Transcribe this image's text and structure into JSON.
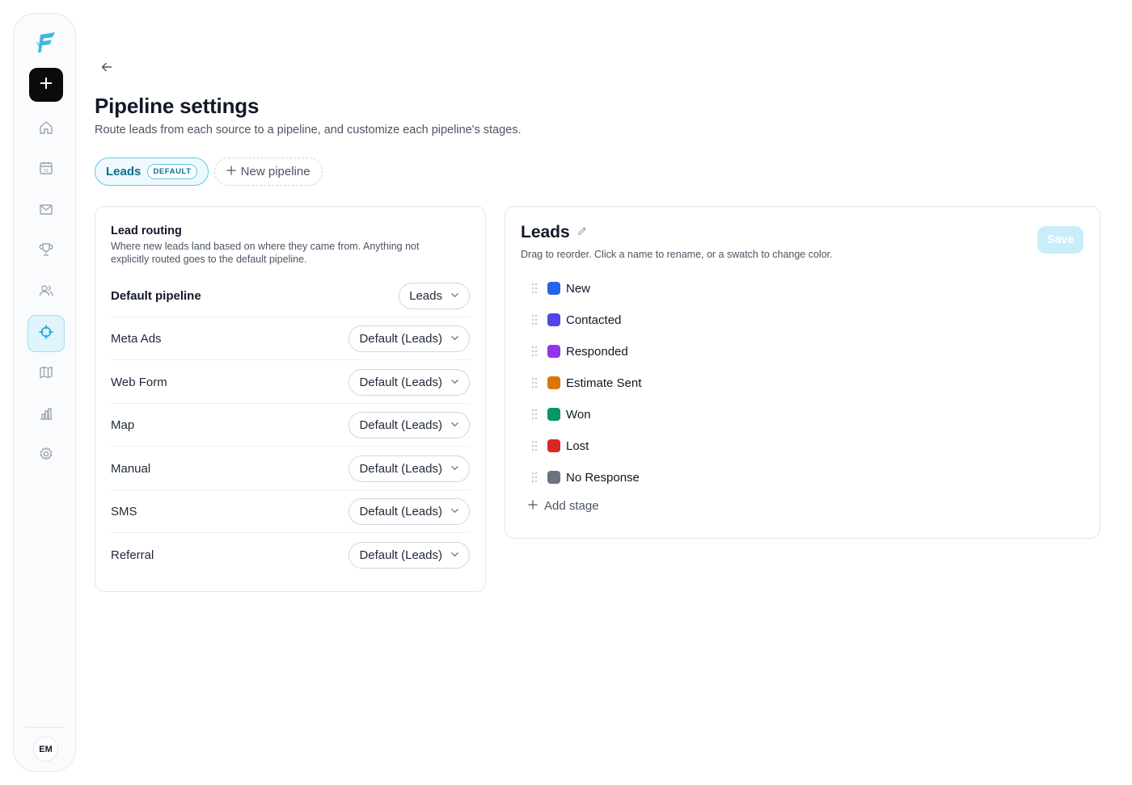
{
  "sidebar": {
    "items": [
      {
        "name": "home-icon",
        "active": false
      },
      {
        "name": "calendar-icon",
        "active": false
      },
      {
        "name": "mail-icon",
        "active": false
      },
      {
        "name": "trophy-icon",
        "active": false
      },
      {
        "name": "users-icon",
        "active": false
      },
      {
        "name": "crosshair-icon",
        "active": true
      },
      {
        "name": "map-icon",
        "active": false
      },
      {
        "name": "bar-chart-icon",
        "active": false
      },
      {
        "name": "gear-icon",
        "active": false
      }
    ],
    "avatar_initials": "EM"
  },
  "header": {
    "title": "Pipeline settings",
    "subtitle": "Route leads from each source to a pipeline, and customize each pipeline's stages."
  },
  "tabs": {
    "active": {
      "label": "Leads",
      "badge": "DEFAULT"
    },
    "new_label": "New pipeline"
  },
  "routing": {
    "title": "Lead routing",
    "description": "Where new leads land based on where they came from. Anything not explicitly routed goes to the default pipeline.",
    "rows": [
      {
        "label": "Default pipeline",
        "value": "Leads"
      },
      {
        "label": "Meta Ads",
        "value": "Default (Leads)"
      },
      {
        "label": "Web Form",
        "value": "Default (Leads)"
      },
      {
        "label": "Map",
        "value": "Default (Leads)"
      },
      {
        "label": "Manual",
        "value": "Default (Leads)"
      },
      {
        "label": "SMS",
        "value": "Default (Leads)"
      },
      {
        "label": "Referral",
        "value": "Default (Leads)"
      }
    ]
  },
  "stages": {
    "title": "Leads",
    "description": "Drag to reorder. Click a name to rename, or a swatch to change color.",
    "save_label": "Save",
    "add_label": "Add stage",
    "items": [
      {
        "name": "New",
        "color": "#2563eb"
      },
      {
        "name": "Contacted",
        "color": "#4f46e5"
      },
      {
        "name": "Responded",
        "color": "#9333ea"
      },
      {
        "name": "Estimate Sent",
        "color": "#d97706"
      },
      {
        "name": "Won",
        "color": "#059669"
      },
      {
        "name": "Lost",
        "color": "#dc2626"
      },
      {
        "name": "No Response",
        "color": "#6b7280"
      }
    ]
  },
  "colors": {
    "accent": "#63c7e6",
    "accent_dark": "#0e6e8c",
    "save_disabled": "#c9eef9"
  }
}
